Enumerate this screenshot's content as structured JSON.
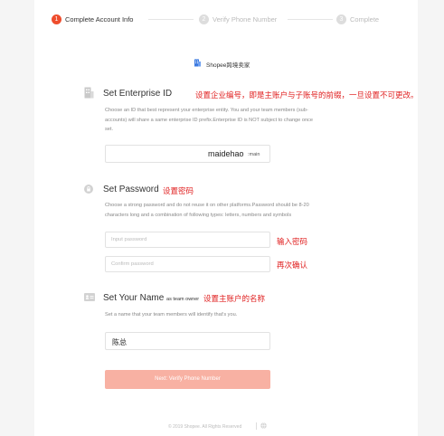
{
  "stepper": {
    "steps": [
      {
        "number": "1",
        "label": "Complete Account Info"
      },
      {
        "number": "2",
        "label": "Verify Phone Number"
      },
      {
        "number": "3",
        "label": "Complete"
      }
    ]
  },
  "brand": {
    "name": "Shopee跨境卖家"
  },
  "enterprise": {
    "title": "Set Enterprise ID",
    "annotation": "设置企业编号，即是主账户与子账号的前缀，一旦设置不可更改。",
    "desc_line1": "Choose an ID that best represent your enterprise entity. You and your team members (sub-",
    "desc_line2": "accounts) will share a same enterprise ID prefix.Enterprise ID is NOT subject to change once",
    "desc_line3": "set.",
    "value": "maidehao",
    "suffix": ":main"
  },
  "password": {
    "title": "Set Password",
    "annotation": "设置密码",
    "desc_line1": "Choose a strong password and do not reuse it on other platforms.Password should be 8-20",
    "desc_line2": "characters long and a combination of following types: letters, numbers and symbols",
    "input_placeholder": "Input password",
    "input_annotation": "输入密码",
    "confirm_placeholder": "Confirm password",
    "confirm_annotation": "再次确认"
  },
  "name": {
    "title": "Set Your Name",
    "title_small": "as team owner",
    "annotation": "设置主账户的名称",
    "desc": "Set a name that your team members will identify that's you.",
    "value": "陈总"
  },
  "next_button": {
    "label": "Next: Verify Phone Number"
  },
  "footer": {
    "copyright": "© 2019 Shopee. All Rights Reserved"
  },
  "colors": {
    "accent": "#ee4d2d",
    "annotation": "#e02020",
    "button_disabled": "#f8b1a3"
  }
}
